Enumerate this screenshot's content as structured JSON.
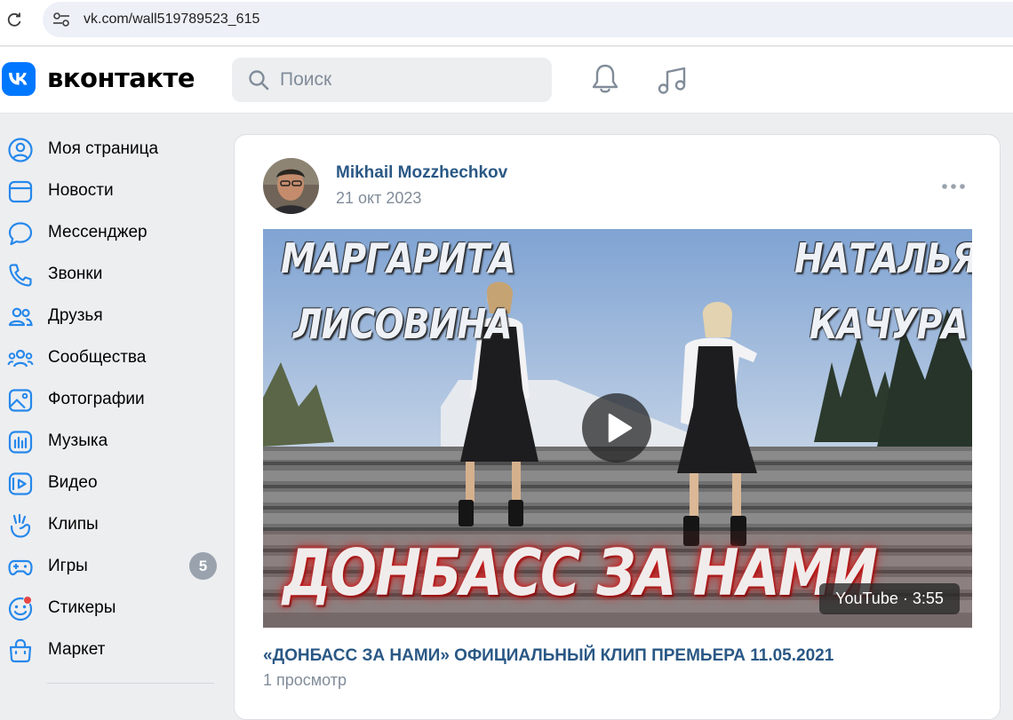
{
  "browser": {
    "url": "vk.com/wall519789523_615"
  },
  "header": {
    "wordmark": "вконтакте",
    "search_placeholder": "Поиск",
    "icons": [
      "bell-icon",
      "music-icon"
    ]
  },
  "sidebar": {
    "items": [
      {
        "label": "Моя страница",
        "icon": "user-circle-icon"
      },
      {
        "label": "Новости",
        "icon": "news-icon"
      },
      {
        "label": "Мессенджер",
        "icon": "message-icon"
      },
      {
        "label": "Звонки",
        "icon": "phone-icon"
      },
      {
        "label": "Друзья",
        "icon": "friends-icon"
      },
      {
        "label": "Сообщества",
        "icon": "communities-icon"
      },
      {
        "label": "Фотографии",
        "icon": "photo-icon"
      },
      {
        "label": "Музыка",
        "icon": "music-icon"
      },
      {
        "label": "Видео",
        "icon": "video-icon"
      },
      {
        "label": "Клипы",
        "icon": "clips-icon"
      },
      {
        "label": "Игры",
        "icon": "games-icon",
        "badge": "5"
      },
      {
        "label": "Стикеры",
        "icon": "stickers-icon"
      },
      {
        "label": "Маркет",
        "icon": "market-icon"
      }
    ]
  },
  "post": {
    "author": "Mikhail Mozzhechkov",
    "date": "21 окт 2023",
    "video": {
      "overlay_left_1": "МАРГАРИТА",
      "overlay_left_2": "ЛИСОВИНА",
      "overlay_right_1": "НАТАЛЬЯ",
      "overlay_right_2": "КАЧУРА",
      "overlay_title": "ДОНБАСС ЗА НАМИ",
      "source_duration": "YouTube · 3:55",
      "title": "«ДОНБАСС ЗА НАМИ» ОФИЦИАЛЬНЫЙ КЛИП ПРЕМЬЕРА 11.05.2021",
      "views": "1 просмотр"
    }
  },
  "colors": {
    "link": "#2a5885",
    "secondary_text": "#818c99",
    "vk_blue": "#0077ff",
    "page_bg": "#edeef0",
    "icon_blue": "#2688eb"
  }
}
